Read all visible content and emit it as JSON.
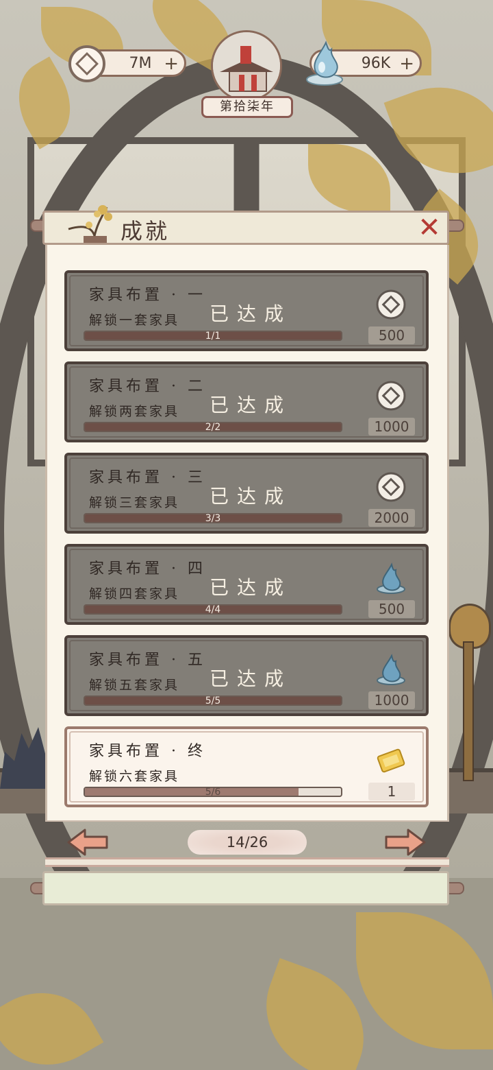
{
  "hud": {
    "coins": {
      "value": "7M",
      "icon": "copper-coin-icon"
    },
    "water": {
      "value": "96K",
      "icon": "water-drop-icon"
    },
    "year_label": "第拾柒年"
  },
  "panel": {
    "title": "成就",
    "close_icon": "close-icon"
  },
  "achievements": [
    {
      "title": "家具布置 · 一",
      "desc": "解锁一套家具",
      "status": "已达成",
      "progress_text": "1/1",
      "progress": 1.0,
      "reward_type": "coin",
      "reward_value": "500"
    },
    {
      "title": "家具布置 · 二",
      "desc": "解锁两套家具",
      "status": "已达成",
      "progress_text": "2/2",
      "progress": 1.0,
      "reward_type": "coin",
      "reward_value": "1000"
    },
    {
      "title": "家具布置 · 三",
      "desc": "解锁三套家具",
      "status": "已达成",
      "progress_text": "3/3",
      "progress": 1.0,
      "reward_type": "coin",
      "reward_value": "2000"
    },
    {
      "title": "家具布置 · 四",
      "desc": "解锁四套家具",
      "status": "已达成",
      "progress_text": "4/4",
      "progress": 1.0,
      "reward_type": "water",
      "reward_value": "500"
    },
    {
      "title": "家具布置 · 五",
      "desc": "解锁五套家具",
      "status": "已达成",
      "progress_text": "5/5",
      "progress": 1.0,
      "reward_type": "water",
      "reward_value": "1000"
    },
    {
      "title": "家具布置 · 终",
      "desc": "解锁六套家具",
      "status": "",
      "progress_text": "5/6",
      "progress": 0.833,
      "reward_type": "ticket",
      "reward_value": "1"
    }
  ],
  "pager": {
    "current": "14/26",
    "prev_icon": "arrow-left-icon",
    "next_icon": "arrow-right-icon"
  },
  "colors": {
    "accent_red": "#b43a34",
    "card_done": "#827e77",
    "card_pending": "#fbf4ec",
    "panel_bg": "#faf5ea"
  }
}
